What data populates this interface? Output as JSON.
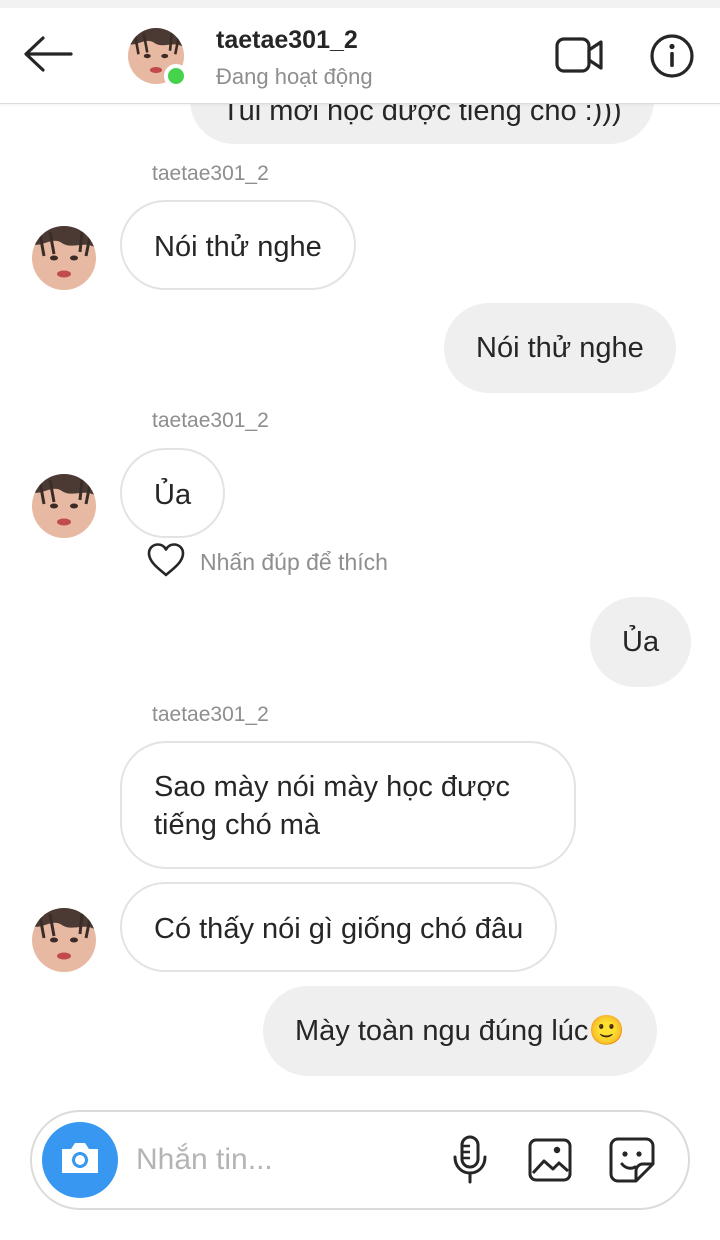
{
  "header": {
    "username": "taetae301_2",
    "status": "Đang hoạt động"
  },
  "messages": [
    {
      "text": "Tui mới học được tiếng chó :)))"
    },
    {
      "sender": "taetae301_2",
      "text": "Nói thử nghe"
    },
    {
      "text": "Nói thử nghe"
    },
    {
      "sender": "taetae301_2",
      "text": "Ủa"
    },
    {
      "text": "Ủa"
    },
    {
      "sender": "taetae301_2",
      "text_line1": "Sao mày nói mày học được",
      "text_line2": "tiếng chó mà"
    },
    {
      "text": "Có thấy nói gì giống chó đâu"
    },
    {
      "text": "Mày toàn ngu đúng lúc",
      "emoji": "🙂"
    }
  ],
  "like_hint": "Nhấn đúp để thích",
  "composer": {
    "placeholder": "Nhắn tin..."
  },
  "colors": {
    "accent": "#3897f0",
    "online": "#44d34a",
    "outgoing_bubble": "#efefef",
    "incoming_border": "#e3e3e3",
    "secondary_text": "#8e8e8e"
  },
  "icons": [
    "back-arrow-icon",
    "video-call-icon",
    "info-icon",
    "heart-icon",
    "camera-icon",
    "microphone-icon",
    "gallery-icon",
    "sticker-icon"
  ]
}
